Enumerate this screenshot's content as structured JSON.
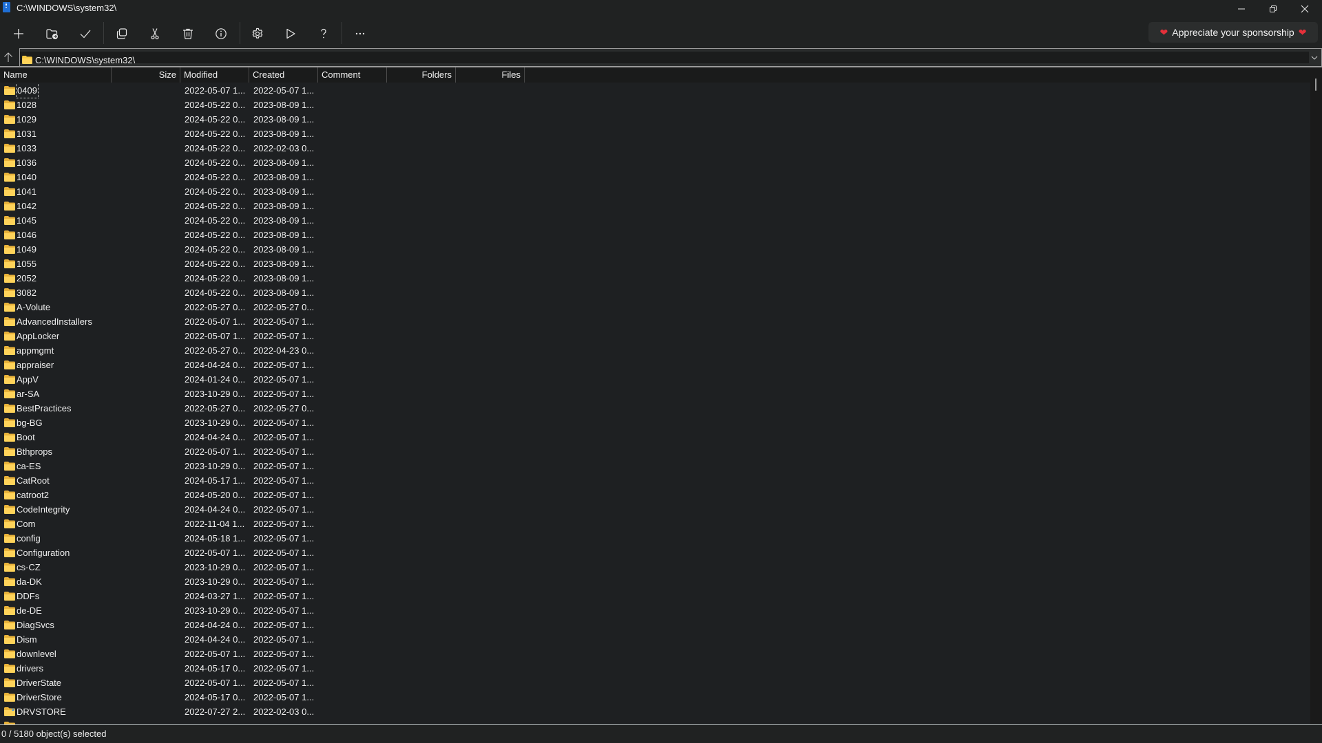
{
  "window": {
    "title": "C:\\WINDOWS\\system32\\",
    "app_icon": "archive-zip-icon",
    "controls": [
      "minimize-icon",
      "restore-icon",
      "close-icon"
    ]
  },
  "toolbar": {
    "buttons": [
      {
        "id": "add",
        "icon": "plus-icon",
        "label": "Add"
      },
      {
        "id": "extract",
        "icon": "folder-extract-icon",
        "label": "Extract"
      },
      {
        "id": "test",
        "icon": "checkmark-icon",
        "label": "Test"
      },
      {
        "id": "copy",
        "icon": "copy-icon",
        "label": "Copy"
      },
      {
        "id": "move",
        "icon": "cut-icon",
        "label": "Move"
      },
      {
        "id": "delete",
        "icon": "trash-icon",
        "label": "Delete"
      },
      {
        "id": "info",
        "icon": "info-icon",
        "label": "Info"
      },
      {
        "id": "settings",
        "icon": "gear-icon",
        "label": "Options"
      },
      {
        "id": "benchmark",
        "icon": "play-icon",
        "label": "Benchmark"
      },
      {
        "id": "help",
        "icon": "question-icon",
        "label": "Help"
      },
      {
        "id": "more",
        "icon": "more-icon",
        "label": "More"
      }
    ],
    "sponsor_label": "Appreciate your sponsorship"
  },
  "address": {
    "path": "C:\\WINDOWS\\system32\\"
  },
  "list": {
    "columns": [
      "Name",
      "Size",
      "Modified",
      "Created",
      "Comment",
      "Folders",
      "Files"
    ],
    "rows": [
      {
        "name": "0409",
        "size": "",
        "modified": "2022-05-07 1...",
        "created": "2022-05-07 1..."
      },
      {
        "name": "1028",
        "size": "",
        "modified": "2024-05-22 0...",
        "created": "2023-08-09 1..."
      },
      {
        "name": "1029",
        "size": "",
        "modified": "2024-05-22 0...",
        "created": "2023-08-09 1..."
      },
      {
        "name": "1031",
        "size": "",
        "modified": "2024-05-22 0...",
        "created": "2023-08-09 1..."
      },
      {
        "name": "1033",
        "size": "",
        "modified": "2024-05-22 0...",
        "created": "2022-02-03 0..."
      },
      {
        "name": "1036",
        "size": "",
        "modified": "2024-05-22 0...",
        "created": "2023-08-09 1..."
      },
      {
        "name": "1040",
        "size": "",
        "modified": "2024-05-22 0...",
        "created": "2023-08-09 1..."
      },
      {
        "name": "1041",
        "size": "",
        "modified": "2024-05-22 0...",
        "created": "2023-08-09 1..."
      },
      {
        "name": "1042",
        "size": "",
        "modified": "2024-05-22 0...",
        "created": "2023-08-09 1..."
      },
      {
        "name": "1045",
        "size": "",
        "modified": "2024-05-22 0...",
        "created": "2023-08-09 1..."
      },
      {
        "name": "1046",
        "size": "",
        "modified": "2024-05-22 0...",
        "created": "2023-08-09 1..."
      },
      {
        "name": "1049",
        "size": "",
        "modified": "2024-05-22 0...",
        "created": "2023-08-09 1..."
      },
      {
        "name": "1055",
        "size": "",
        "modified": "2024-05-22 0...",
        "created": "2023-08-09 1..."
      },
      {
        "name": "2052",
        "size": "",
        "modified": "2024-05-22 0...",
        "created": "2023-08-09 1..."
      },
      {
        "name": "3082",
        "size": "",
        "modified": "2024-05-22 0...",
        "created": "2023-08-09 1..."
      },
      {
        "name": "A-Volute",
        "size": "",
        "modified": "2022-05-27 0...",
        "created": "2022-05-27 0..."
      },
      {
        "name": "AdvancedInstallers",
        "size": "",
        "modified": "2022-05-07 1...",
        "created": "2022-05-07 1..."
      },
      {
        "name": "AppLocker",
        "size": "",
        "modified": "2022-05-07 1...",
        "created": "2022-05-07 1..."
      },
      {
        "name": "appmgmt",
        "size": "",
        "modified": "2022-05-27 0...",
        "created": "2022-04-23 0..."
      },
      {
        "name": "appraiser",
        "size": "",
        "modified": "2024-04-24 0...",
        "created": "2022-05-07 1..."
      },
      {
        "name": "AppV",
        "size": "",
        "modified": "2024-01-24 0...",
        "created": "2022-05-07 1..."
      },
      {
        "name": "ar-SA",
        "size": "",
        "modified": "2023-10-29 0...",
        "created": "2022-05-07 1..."
      },
      {
        "name": "BestPractices",
        "size": "",
        "modified": "2022-05-27 0...",
        "created": "2022-05-27 0..."
      },
      {
        "name": "bg-BG",
        "size": "",
        "modified": "2023-10-29 0...",
        "created": "2022-05-07 1..."
      },
      {
        "name": "Boot",
        "size": "",
        "modified": "2024-04-24 0...",
        "created": "2022-05-07 1..."
      },
      {
        "name": "Bthprops",
        "size": "",
        "modified": "2022-05-07 1...",
        "created": "2022-05-07 1..."
      },
      {
        "name": "ca-ES",
        "size": "",
        "modified": "2023-10-29 0...",
        "created": "2022-05-07 1..."
      },
      {
        "name": "CatRoot",
        "size": "",
        "modified": "2024-05-17 1...",
        "created": "2022-05-07 1..."
      },
      {
        "name": "catroot2",
        "size": "",
        "modified": "2024-05-20 0...",
        "created": "2022-05-07 1..."
      },
      {
        "name": "CodeIntegrity",
        "size": "",
        "modified": "2024-04-24 0...",
        "created": "2022-05-07 1..."
      },
      {
        "name": "Com",
        "size": "",
        "modified": "2022-11-04 1...",
        "created": "2022-05-07 1..."
      },
      {
        "name": "config",
        "size": "",
        "modified": "2024-05-18 1...",
        "created": "2022-05-07 1..."
      },
      {
        "name": "Configuration",
        "size": "",
        "modified": "2022-05-07 1...",
        "created": "2022-05-07 1..."
      },
      {
        "name": "cs-CZ",
        "size": "",
        "modified": "2023-10-29 0...",
        "created": "2022-05-07 1..."
      },
      {
        "name": "da-DK",
        "size": "",
        "modified": "2023-10-29 0...",
        "created": "2022-05-07 1..."
      },
      {
        "name": "DDFs",
        "size": "",
        "modified": "2024-03-27 1...",
        "created": "2022-05-07 1..."
      },
      {
        "name": "de-DE",
        "size": "",
        "modified": "2023-10-29 0...",
        "created": "2022-05-07 1..."
      },
      {
        "name": "DiagSvcs",
        "size": "",
        "modified": "2024-04-24 0...",
        "created": "2022-05-07 1..."
      },
      {
        "name": "Dism",
        "size": "",
        "modified": "2024-04-24 0...",
        "created": "2022-05-07 1..."
      },
      {
        "name": "downlevel",
        "size": "",
        "modified": "2022-05-07 1...",
        "created": "2022-05-07 1..."
      },
      {
        "name": "drivers",
        "size": "",
        "modified": "2024-05-17 0...",
        "created": "2022-05-07 1..."
      },
      {
        "name": "DriverState",
        "size": "",
        "modified": "2022-05-07 1...",
        "created": "2022-05-07 1..."
      },
      {
        "name": "DriverStore",
        "size": "",
        "modified": "2024-05-17 0...",
        "created": "2022-05-07 1..."
      },
      {
        "name": "DRVSTORE",
        "size": "",
        "modified": "2022-07-27 2...",
        "created": "2022-02-03 0...",
        "shortcut": true
      }
    ]
  },
  "status": {
    "text": "0 / 5180 object(s) selected"
  },
  "colors": {
    "background": "#202222",
    "list_background": "#1e2022",
    "folder_yellow": "#f5c842",
    "heart_red": "#e5303a",
    "app_icon_blue": "#1f6fd6"
  }
}
